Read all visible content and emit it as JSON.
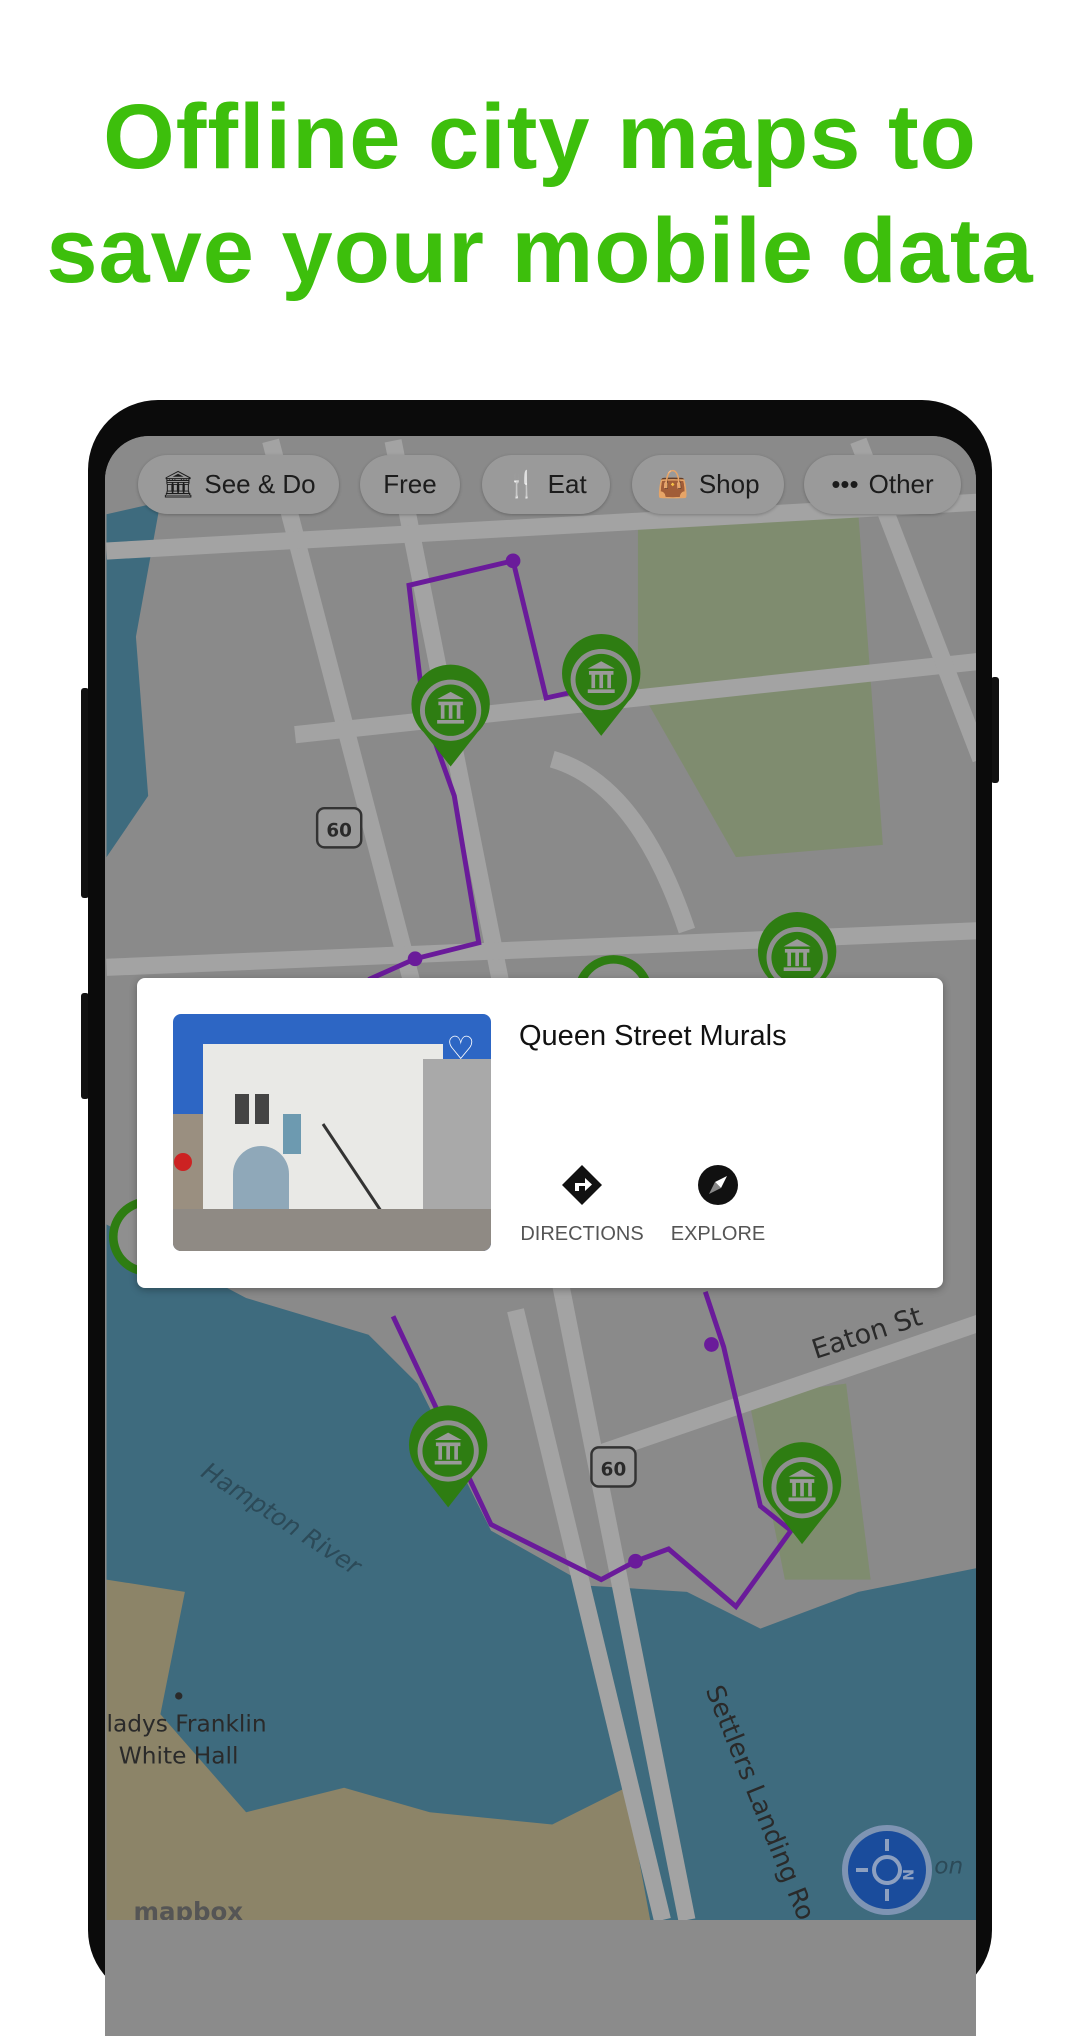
{
  "headline": {
    "line1": "Offline city maps to",
    "line2": "save your mobile data",
    "color": "#3dbf0c"
  },
  "chips": [
    {
      "label": "See & Do",
      "icon": "museum-icon"
    },
    {
      "label": "Free",
      "icon": ""
    },
    {
      "label": "Eat",
      "icon": "fork-knife-icon"
    },
    {
      "label": "Shop",
      "icon": "shopping-bag-icon"
    },
    {
      "label": "Other",
      "icon": "more-dots-icon"
    }
  ],
  "map": {
    "labels": {
      "highway1": "60",
      "highway2": "60",
      "street": "Eaton St",
      "river": "Hampton River",
      "poi_line1": "ladys Franklin",
      "poi_line2": "White Hall",
      "road": "Settlers Landing Ro",
      "edge": "on",
      "attribution": "mapbox"
    },
    "route_color": "#6a1b9a",
    "pin_color": "#2e7d12"
  },
  "card": {
    "title": "Queen Street Murals",
    "favorite_icon": "heart-outline-icon",
    "actions": [
      {
        "label": "DIRECTIONS",
        "icon": "directions-icon"
      },
      {
        "label": "EXPLORE",
        "icon": "compass-icon"
      }
    ]
  },
  "compass_button": {
    "icon": "compass-north-icon"
  }
}
